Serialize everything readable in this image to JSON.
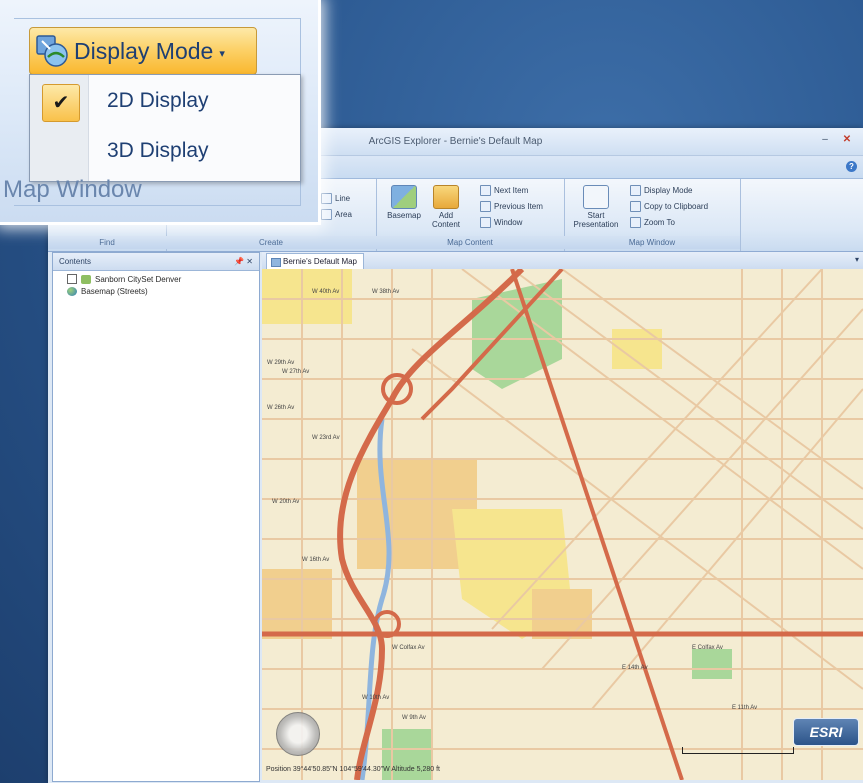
{
  "window": {
    "title": "ArcGIS Explorer - Bernie's Default Map",
    "minimize": "–",
    "close": "✕",
    "help": "?"
  },
  "ribbon": {
    "groups": [
      {
        "name": "Find",
        "label": "Find"
      },
      {
        "name": "Create",
        "label": "Create"
      },
      {
        "name": "Map Content",
        "label": "Map Content"
      },
      {
        "name": "Map Window",
        "label": "Map Window"
      }
    ],
    "create_items": [
      "Line",
      "Area"
    ],
    "basemap_label": "Basemap",
    "add_content_label": "Add Content",
    "map_content_items": [
      "Next Item",
      "Previous Item",
      "Window"
    ],
    "start_presentation_label": "Start Presentation",
    "map_window_items": [
      "Display Mode",
      "Copy to Clipboard",
      "Zoom To"
    ]
  },
  "contents_panel": {
    "title": "Contents",
    "pin": "📌",
    "close": "✕",
    "layers": [
      {
        "label": "Sanborn CitySet Denver",
        "icon": "layer-icon"
      },
      {
        "label": "Basemap (Streets)",
        "icon": "globe-icon"
      }
    ]
  },
  "map": {
    "tab_label": "Bernie's Default Map",
    "dropdown": "▾",
    "logo": "ESRI",
    "status": "Position 39°44'50.85\"N 104°59'44.30\"W  Altitude 5,280 ft"
  },
  "callout": {
    "display_mode_label": "Display Mode",
    "dropdown_arrow": "▾",
    "check": "✔",
    "menu_items": [
      {
        "label": "2D Display",
        "checked": true
      },
      {
        "label": "3D Display",
        "checked": false
      }
    ],
    "group_label": "Map Window"
  },
  "colors": {
    "desktop": "#2a578f",
    "ribbon_highlight": "#f9c14a",
    "menu_text": "#1e3f73",
    "map_land": "#f4ecd2",
    "highway": "#d46a4a",
    "river": "#8fb5de",
    "park": "#a9d79a"
  }
}
